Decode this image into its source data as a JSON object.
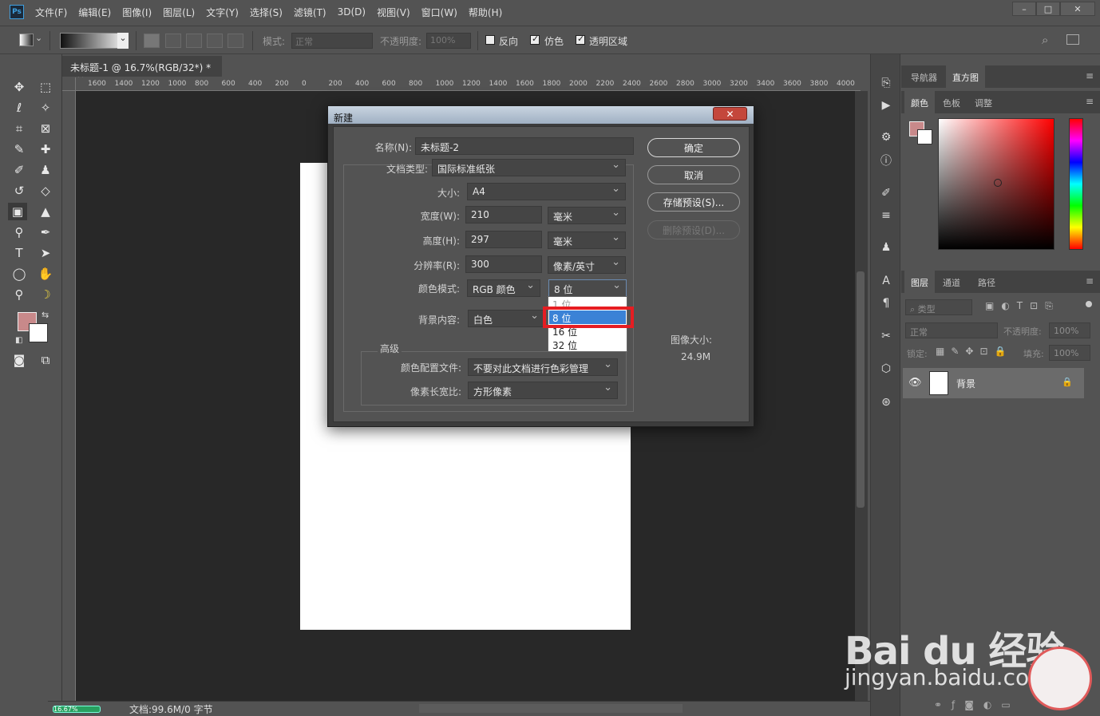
{
  "app": {
    "logo": "Ps"
  },
  "menu": [
    "文件(F)",
    "编辑(E)",
    "图像(I)",
    "图层(L)",
    "文字(Y)",
    "选择(S)",
    "滤镜(T)",
    "3D(D)",
    "视图(V)",
    "窗口(W)",
    "帮助(H)"
  ],
  "window_controls": {
    "minimize": "–",
    "maximize": "□",
    "close": "✕"
  },
  "options": {
    "mode_label": "模式:",
    "mode_value": "正常",
    "opacity_label": "不透明度:",
    "opacity_value": "100%",
    "reverse": "反向",
    "dither": "仿色",
    "transparency": "透明区域"
  },
  "doc_tab": {
    "title": "未标题-1 @ 16.7%(RGB/32*) *",
    "close": "×"
  },
  "ruler_top": [
    "1600",
    "1400",
    "1200",
    "1000",
    "800",
    "600",
    "400",
    "200",
    "0",
    "200",
    "400",
    "600",
    "800",
    "1000",
    "1200",
    "1400",
    "1600",
    "1800",
    "2000",
    "2200",
    "2400",
    "2600",
    "2800",
    "3000",
    "3200",
    "3400",
    "3600",
    "3800",
    "4000"
  ],
  "status": {
    "zoom": "16.67%",
    "doc_info": "文档:99.6M/0 字节"
  },
  "panels": {
    "top_tabs": [
      "导航器",
      "直方图"
    ],
    "color_tabs": [
      "颜色",
      "色板",
      "调整"
    ],
    "layers_tabs": [
      "图层",
      "通道",
      "路径"
    ],
    "layers_kind": "类型",
    "blend_mode": "正常",
    "opacity_label": "不透明度:",
    "opacity_value": "100%",
    "lock_label": "锁定:",
    "fill_label": "填充:",
    "fill_value": "100%",
    "layer_name": "背景",
    "fg_color": "#c8898a",
    "bg_color": "#ffffff"
  },
  "dialog": {
    "title": "新建",
    "close": "✕",
    "name_label": "名称(N):",
    "name_value": "未标题-2",
    "doctype_label": "文档类型:",
    "doctype_value": "国际标准纸张",
    "size_label": "大小:",
    "size_value": "A4",
    "width_label": "宽度(W):",
    "width_value": "210",
    "width_unit": "毫米",
    "height_label": "高度(H):",
    "height_value": "297",
    "height_unit": "毫米",
    "res_label": "分辨率(R):",
    "res_value": "300",
    "res_unit": "像素/英寸",
    "colormode_label": "颜色模式:",
    "colormode_value": "RGB 颜色",
    "bitdepth_value": "8 位",
    "bg_label": "背景内容:",
    "bg_value": "白色",
    "advanced": "高级",
    "profile_label": "颜色配置文件:",
    "profile_value": "不要对此文档进行色彩管理",
    "pixel_label": "像素长宽比:",
    "pixel_value": "方形像素",
    "ok": "确定",
    "cancel": "取消",
    "save_preset": "存储预设(S)...",
    "delete_preset": "删除预设(D)...",
    "image_size_label": "图像大小:",
    "image_size_value": "24.9M",
    "bitdepth_options": [
      "1 位",
      "8 位",
      "16 位",
      "32 位"
    ],
    "bitdepth_selected": "8 位"
  },
  "watermark": {
    "brand": "Bai du 经验",
    "url": "jingyan.baidu.com"
  },
  "highlight_color": "#e61d22"
}
